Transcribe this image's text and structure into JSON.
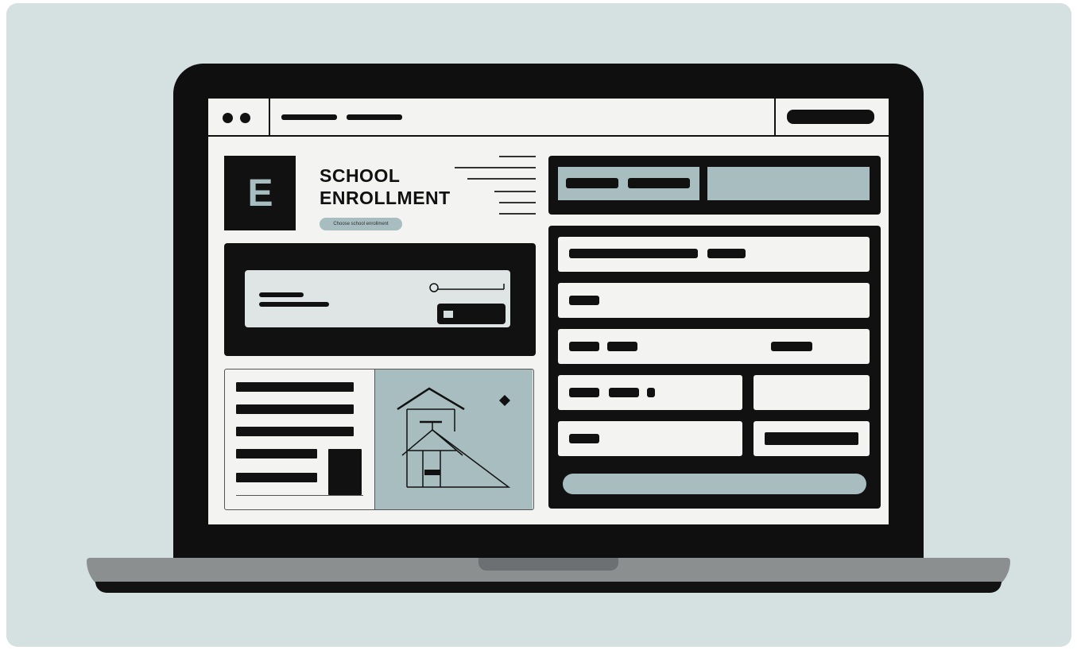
{
  "page": {
    "title_line1": "SCHOOL",
    "title_line2": "ENROLLMENT",
    "logo_letter": "E",
    "pill_text": "Choose school enrollment"
  },
  "colors": {
    "background": "#d5e0e1",
    "accent": "#a7bdbf",
    "ink": "#111111",
    "screen": "#f3f4f2"
  },
  "icons": [
    "window-control-dot",
    "search-icon",
    "school-building-icon",
    "diamond-icon"
  ]
}
